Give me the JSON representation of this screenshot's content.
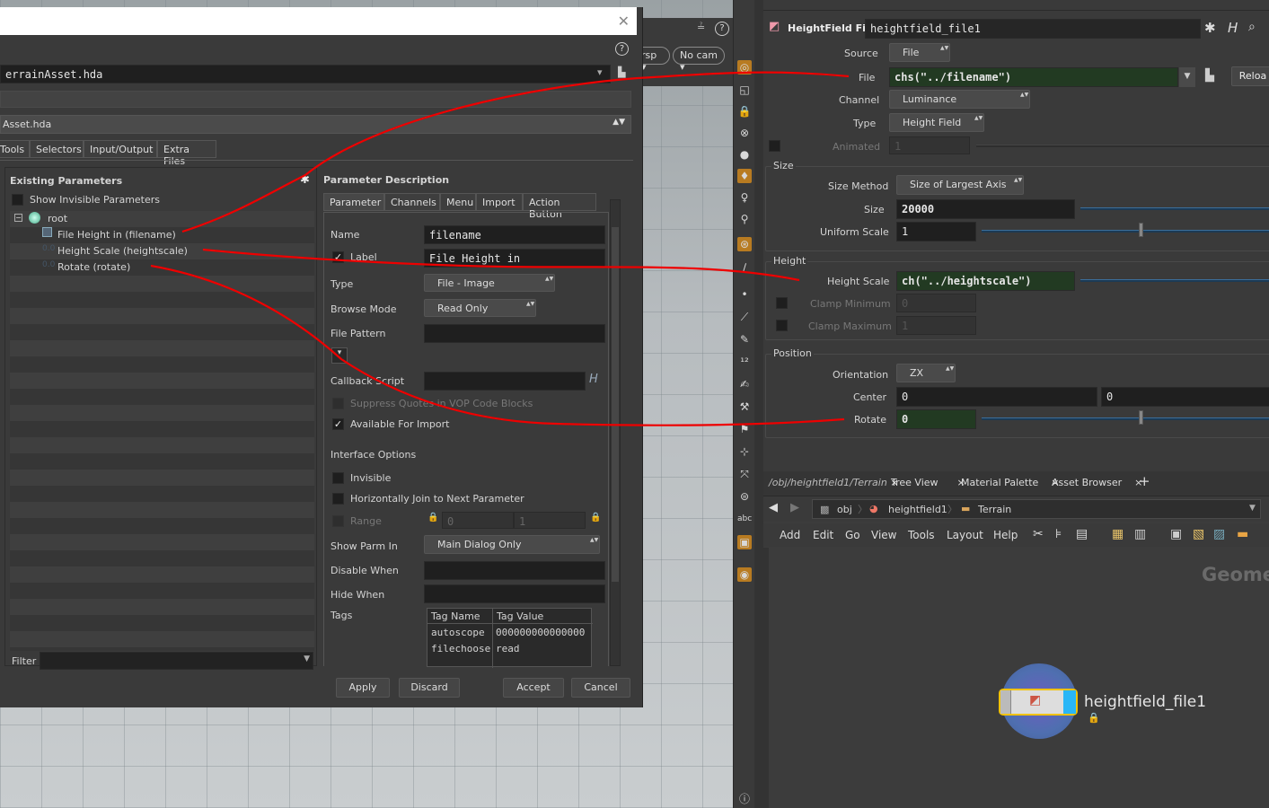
{
  "dialog": {
    "hda_path": "errainAsset.hda",
    "hda_label": "Asset.hda",
    "tabs": [
      "Tools",
      "Selectors",
      "Input/Output",
      "Extra Files"
    ],
    "existing_title": "Existing Parameters",
    "show_invisible": "Show Invisible Parameters",
    "tree": {
      "root": "root",
      "items": [
        "File Height in (filename)",
        "Height Scale (heightscale)",
        "Rotate (rotate)"
      ]
    },
    "filter_label": "Filter",
    "desc_title": "Parameter Description",
    "desc_tabs": [
      "Parameter",
      "Channels",
      "Menu",
      "Import",
      "Action Button"
    ],
    "name_label": "Name",
    "name_value": "filename",
    "label_label": "Label",
    "label_value": "File Height in",
    "type_label": "Type",
    "type_value": "File - Image",
    "browse_label": "Browse Mode",
    "browse_value": "Read Only",
    "pattern_label": "File Pattern",
    "callback_label": "Callback Script",
    "suppress_label": "Suppress Quotes in VOP Code Blocks",
    "available_label": "Available For Import",
    "interface_label": "Interface Options",
    "invisible_label": "Invisible",
    "hjoin_label": "Horizontally Join to Next Parameter",
    "range_label": "Range",
    "range_min": "0",
    "range_max": "1",
    "showparm_label": "Show Parm In",
    "showparm_value": "Main Dialog Only",
    "disable_label": "Disable When",
    "hide_label": "Hide When",
    "tags_label": "Tags",
    "tag_headers": [
      "Tag Name",
      "Tag Value"
    ],
    "tag_rows": [
      [
        "autoscope",
        "000000000000000"
      ],
      [
        "filechoose",
        "read"
      ]
    ],
    "buttons": {
      "apply": "Apply",
      "discard": "Discard",
      "accept": "Accept",
      "cancel": "Cancel"
    }
  },
  "viewport": {
    "persp": "rsp",
    "cam": "No cam"
  },
  "param": {
    "node_type": "HeightField File",
    "node_name": "heightfield_file1",
    "source_label": "Source",
    "source_value": "File",
    "file_label": "File",
    "file_value": "chs(\"../filename\")",
    "reload": "Reloa",
    "channel_label": "Channel",
    "channel_value": "Luminance",
    "type_label": "Type",
    "type_value": "Height Field",
    "animated_label": "Animated",
    "animated_value": "1",
    "size_section": "Size",
    "sizemethod_label": "Size Method",
    "sizemethod_value": "Size of Largest Axis",
    "size_label": "Size",
    "size_value": "20000",
    "uniform_label": "Uniform Scale",
    "uniform_value": "1",
    "height_section": "Height",
    "hscale_label": "Height Scale",
    "hscale_value": "ch(\"../heightscale\")",
    "clampmin_label": "Clamp Minimum",
    "clampmin_value": "0",
    "clampmax_label": "Clamp Maximum",
    "clampmax_value": "1",
    "position_section": "Position",
    "orient_label": "Orientation",
    "orient_value": "ZX",
    "center_label": "Center",
    "center_x": "0",
    "center_y": "0",
    "rotate_label": "Rotate",
    "rotate_value": "0"
  },
  "network": {
    "tabs": [
      "/obj/heightfield1/Terrain",
      "Tree View",
      "Material Palette",
      "Asset Browser"
    ],
    "path": [
      "obj",
      "heightfield1",
      "Terrain"
    ],
    "menus": [
      "Add",
      "Edit",
      "Go",
      "View",
      "Tools",
      "Layout",
      "Help"
    ],
    "context": "Geome",
    "node_label": "heightfield_file1"
  },
  "shelf_text": "abc",
  "colors": {
    "wire": "#e00000",
    "accent": "#b87b21",
    "panel": "#3a3a3a"
  }
}
